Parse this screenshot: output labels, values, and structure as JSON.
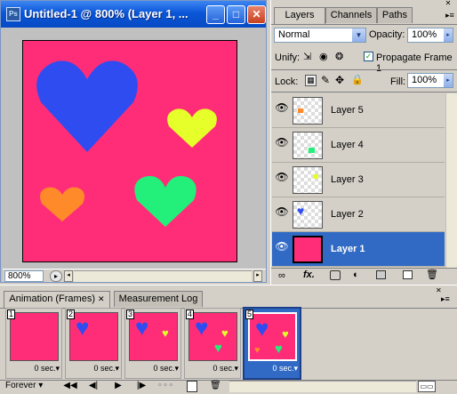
{
  "document": {
    "title": "Untitled-1 @ 800% (Layer 1, ...",
    "zoom": "800%",
    "canvas_color": "#ff2d78"
  },
  "window_buttons": {
    "minimize": "_",
    "maximize": "□",
    "close": "✕"
  },
  "layers_panel": {
    "tabs": [
      "Layers",
      "Channels",
      "Paths"
    ],
    "blend_mode": "Normal",
    "opacity_label": "Opacity:",
    "opacity_value": "100%",
    "unify_label": "Unify:",
    "propagate_label": "Propagate Frame 1",
    "propagate_checked": true,
    "lock_label": "Lock:",
    "fill_label": "Fill:",
    "fill_value": "100%",
    "layers": [
      {
        "name": "Layer 5",
        "selected": false
      },
      {
        "name": "Layer 4",
        "selected": false
      },
      {
        "name": "Layer 3",
        "selected": false
      },
      {
        "name": "Layer 2",
        "selected": false
      },
      {
        "name": "Layer 1",
        "selected": true
      }
    ]
  },
  "animation_panel": {
    "tabs": [
      "Animation (Frames)",
      "Measurement Log"
    ],
    "frames": [
      {
        "number": "1",
        "delay": "0 sec."
      },
      {
        "number": "2",
        "delay": "0 sec."
      },
      {
        "number": "3",
        "delay": "0 sec."
      },
      {
        "number": "4",
        "delay": "0 sec."
      },
      {
        "number": "5",
        "delay": "0 sec.",
        "selected": true
      }
    ],
    "loop": "Forever"
  },
  "colors": {
    "pink": "#ff2d78",
    "blue": "#2f4cf0",
    "yellow": "#e6ff2a",
    "green": "#22f07a",
    "orange": "#ff8a2a",
    "selection": "#316ac5"
  }
}
